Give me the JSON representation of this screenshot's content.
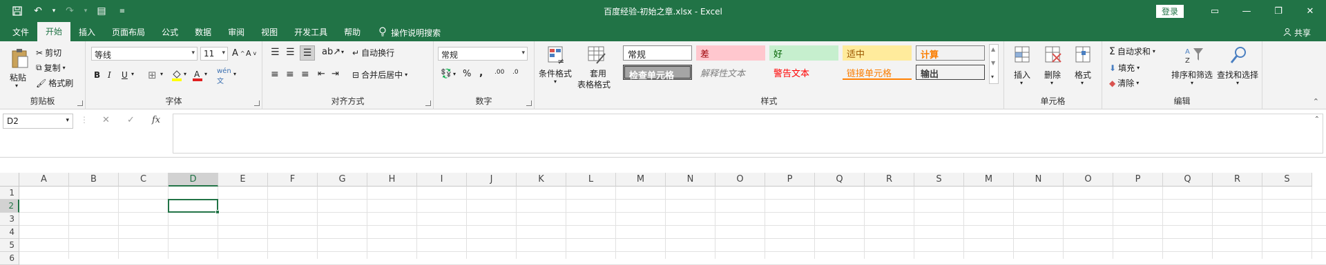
{
  "window": {
    "title": "百度经验-初始之章.xlsx  -  Excel",
    "login": "登录"
  },
  "tabs": [
    "文件",
    "开始",
    "插入",
    "页面布局",
    "公式",
    "数据",
    "审阅",
    "视图",
    "开发工具",
    "帮助"
  ],
  "tell_me": "操作说明搜索",
  "share": "共享",
  "ribbon": {
    "clipboard": {
      "label": "剪贴板",
      "paste": "粘贴",
      "cut": "剪切",
      "copy": "复制",
      "format_painter": "格式刷"
    },
    "font": {
      "label": "字体",
      "font_name": "等线",
      "font_size": "11",
      "bold": "B",
      "italic": "I",
      "underline": "U"
    },
    "alignment": {
      "label": "对齐方式",
      "wrap": "自动换行",
      "merge": "合并后居中"
    },
    "number": {
      "label": "数字",
      "format": "常规",
      "percent": "%",
      "comma": ",",
      "inc_dec": ".00",
      "dec_dec": ".0"
    },
    "styles": {
      "label": "样式",
      "conditional": "条件格式",
      "table_format_1": "套用",
      "table_format_2": "表格格式",
      "cells": {
        "normal": "常规",
        "bad": "差",
        "good": "好",
        "neutral": "适中",
        "calculation": "计算",
        "check_cell": "检查单元格",
        "explanatory": "解释性文本",
        "warning": "警告文本",
        "linked": "链接单元格",
        "output": "输出"
      }
    },
    "cells": {
      "label": "单元格",
      "insert": "插入",
      "delete": "删除",
      "format": "格式"
    },
    "editing": {
      "label": "编辑",
      "autosum": "自动求和",
      "fill": "填充",
      "clear": "清除",
      "sort": "排序和筛选",
      "find": "查找和选择"
    }
  },
  "formula_bar": {
    "name_box": "D2",
    "fx": "fx",
    "content": ""
  },
  "sheet": {
    "columns": [
      "A",
      "B",
      "C",
      "D",
      "E",
      "F",
      "G",
      "H",
      "I",
      "J",
      "K",
      "L",
      "M",
      "N",
      "O",
      "P",
      "Q",
      "R",
      "S",
      "M",
      "N",
      "O",
      "P",
      "Q",
      "R",
      "S"
    ],
    "rows": [
      "1",
      "2",
      "3",
      "4",
      "5",
      "6"
    ],
    "selected_column": "D",
    "selected_row": "2"
  },
  "colors": {
    "accent": "#217346"
  }
}
